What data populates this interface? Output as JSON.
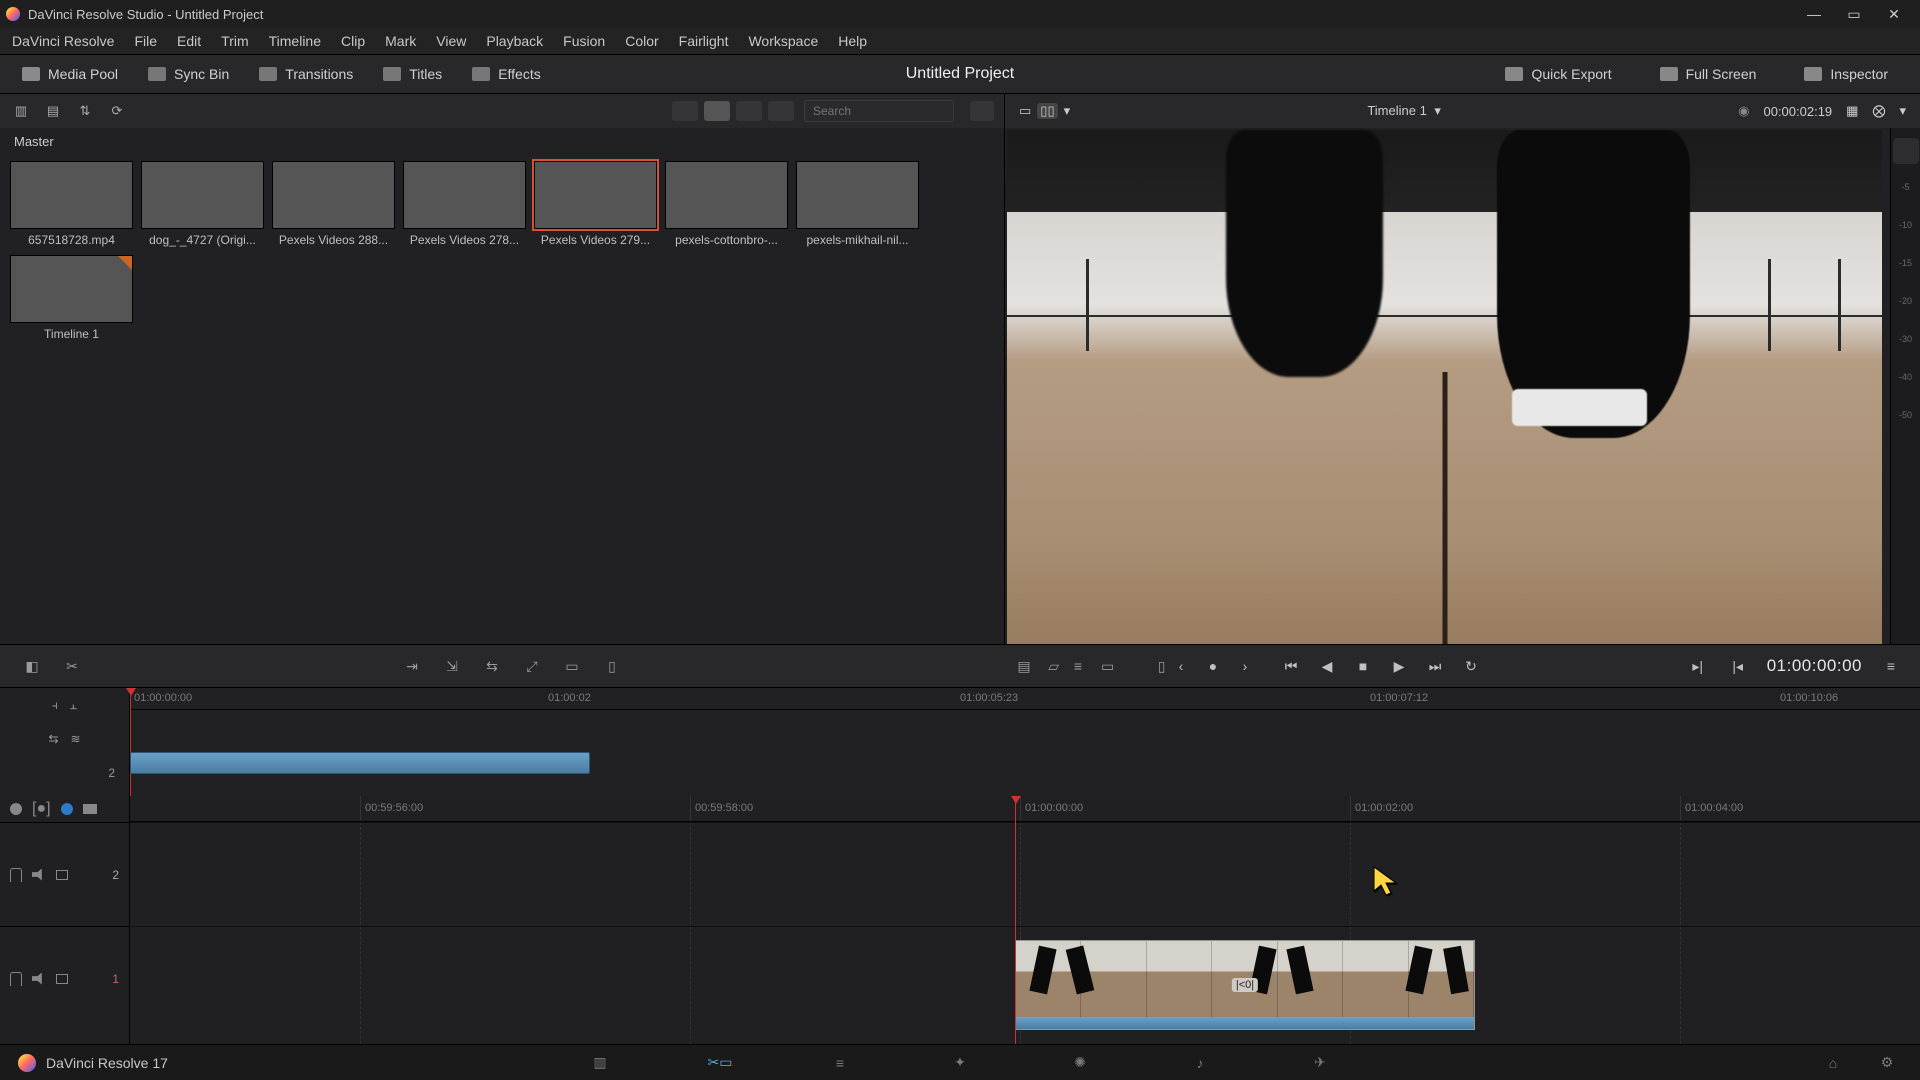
{
  "window": {
    "title": "DaVinci Resolve Studio - Untitled Project"
  },
  "menus": [
    "DaVinci Resolve",
    "File",
    "Edit",
    "Trim",
    "Timeline",
    "Clip",
    "Mark",
    "View",
    "Playback",
    "Fusion",
    "Color",
    "Fairlight",
    "Workspace",
    "Help"
  ],
  "topbar": {
    "media_pool": "Media Pool",
    "sync_bin": "Sync Bin",
    "transitions": "Transitions",
    "titles": "Titles",
    "effects": "Effects",
    "project_title": "Untitled Project",
    "quick_export": "Quick Export",
    "full_screen": "Full Screen",
    "inspector": "Inspector"
  },
  "pool": {
    "master_label": "Master",
    "search_placeholder": "Search",
    "clips": [
      {
        "name": "657518728.mp4",
        "sel": false,
        "th": "th-road"
      },
      {
        "name": "dog_-_4727 (Origi...",
        "sel": false,
        "th": "th-dog"
      },
      {
        "name": "Pexels Videos 288...",
        "sel": false,
        "th": "th-bride"
      },
      {
        "name": "Pexels Videos 278...",
        "sel": false,
        "th": "th-girl"
      },
      {
        "name": "Pexels Videos 279...",
        "sel": true,
        "th": "th-run"
      },
      {
        "name": "pexels-cottonbro-...",
        "sel": false,
        "th": "th-park"
      },
      {
        "name": "pexels-mikhail-nil...",
        "sel": false,
        "th": "th-field"
      },
      {
        "name": "Timeline 1",
        "sel": false,
        "th": "th-tl"
      }
    ]
  },
  "viewer": {
    "timeline_name": "Timeline 1",
    "timecode_left": "00:00:02:19",
    "meter_ticks": [
      "-5",
      "-10",
      "-15",
      "-20",
      "-30",
      "-40",
      "-50"
    ]
  },
  "transport": {
    "timecode_right": "01:00:00:00"
  },
  "mini_timeline": {
    "ruler": [
      "01:00:00:00",
      "01:00:02",
      "01:00:05:23",
      "01:00:07:12",
      "01:00:10:06"
    ]
  },
  "timeline": {
    "ruler": [
      "00:59:56:00",
      "00:59:58:00",
      "01:00:00:00",
      "01:00:02:00",
      "01:00:04:00"
    ],
    "tracks": [
      {
        "num": "2"
      },
      {
        "num": "1"
      }
    ],
    "clip_center_label": "|<0|"
  },
  "bottombar": {
    "brand": "DaVinci Resolve 17",
    "pages": [
      "media",
      "cut",
      "edit",
      "fusion",
      "color",
      "fairlight",
      "deliver"
    ]
  }
}
